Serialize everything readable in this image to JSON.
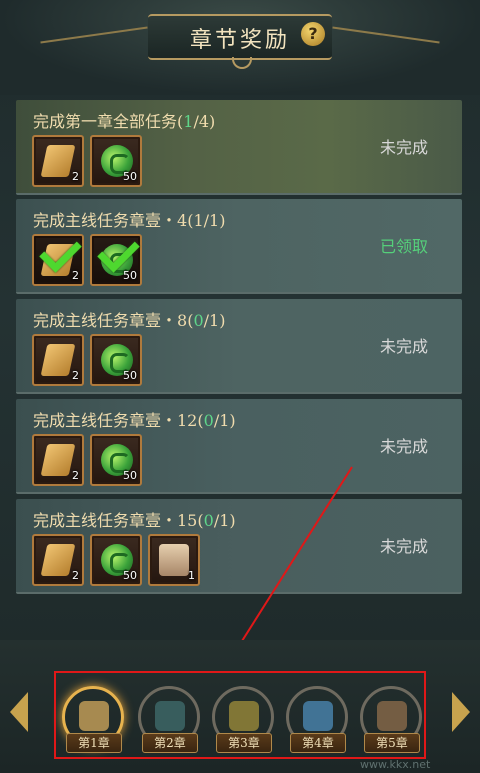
{
  "header": {
    "title": "章节奖励",
    "help_label": "?"
  },
  "tasks": [
    {
      "name": "完成第一章全部任务",
      "progress_prefix": "(",
      "progress_done": "1",
      "progress_rest": "/4)",
      "status": "未完成",
      "items": [
        {
          "icon": "scroll-icon",
          "count": "2"
        },
        {
          "icon": "jade-icon",
          "count": "50"
        }
      ]
    },
    {
      "name": "完成主线任务章壹・4",
      "progress_prefix": "(",
      "progress_done": "1",
      "progress_rest": "/1)",
      "status": "已领取",
      "items": [
        {
          "icon": "scroll-icon",
          "count": "2"
        },
        {
          "icon": "jade-icon",
          "count": "50"
        }
      ]
    },
    {
      "name": "完成主线任务章壹・8",
      "progress_prefix": "(",
      "progress_done": "0",
      "progress_rest": "/1)",
      "status": "未完成",
      "items": [
        {
          "icon": "scroll-icon",
          "count": "2"
        },
        {
          "icon": "jade-icon",
          "count": "50"
        }
      ]
    },
    {
      "name": "完成主线任务章壹・12",
      "progress_prefix": "(",
      "progress_done": "0",
      "progress_rest": "/1)",
      "status": "未完成",
      "items": [
        {
          "icon": "scroll-icon",
          "count": "2"
        },
        {
          "icon": "jade-icon",
          "count": "50"
        }
      ]
    },
    {
      "name": "完成主线任务章壹・15",
      "progress_prefix": "(",
      "progress_done": "0",
      "progress_rest": "/1)",
      "status": "未完成",
      "items": [
        {
          "icon": "scroll-icon",
          "count": "2"
        },
        {
          "icon": "jade-icon",
          "count": "50"
        },
        {
          "icon": "box-icon",
          "count": "1"
        }
      ]
    }
  ],
  "chapters": [
    {
      "label": "第1章",
      "selected": true,
      "color": "#c9a35a"
    },
    {
      "label": "第2章",
      "selected": false,
      "color": "#3e6a6a"
    },
    {
      "label": "第3章",
      "selected": false,
      "color": "#9a8a3a"
    },
    {
      "label": "第4章",
      "selected": false,
      "color": "#4a86b0"
    },
    {
      "label": "第5章",
      "selected": false,
      "color": "#8a6a4a"
    }
  ],
  "watermark": "www.kkx.net",
  "colors": {
    "accent": "#f0dcae",
    "claimed": "#55d07a",
    "highlight": "#e01818"
  }
}
